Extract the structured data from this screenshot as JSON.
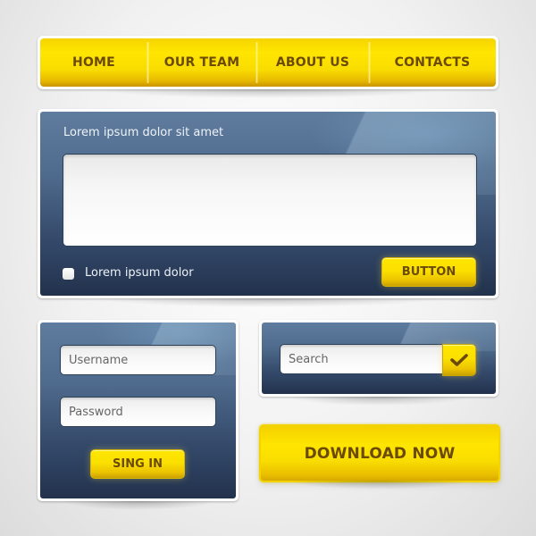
{
  "nav": {
    "items": [
      {
        "label": "HOME"
      },
      {
        "label": "OUR TEAM"
      },
      {
        "label": "ABOUT US"
      },
      {
        "label": "CONTACTS"
      }
    ]
  },
  "comment_panel": {
    "title": "Lorem ipsum dolor sit amet",
    "textarea_value": "",
    "checkbox_label": "Lorem ipsum dolor",
    "checkbox_checked": false,
    "button_label": "BUTTON"
  },
  "login_panel": {
    "username_placeholder": "Username",
    "password_placeholder": "Password",
    "signin_label": "SING IN"
  },
  "search_panel": {
    "search_placeholder": "Search",
    "submit_icon": "check-icon"
  },
  "download": {
    "label": "DOWNLOAD NOW"
  },
  "colors": {
    "accent_yellow": "#ffe600",
    "text_brown": "#6b4a05",
    "panel_blue_top": "#5f7c9e",
    "panel_blue_bottom": "#22324d"
  }
}
